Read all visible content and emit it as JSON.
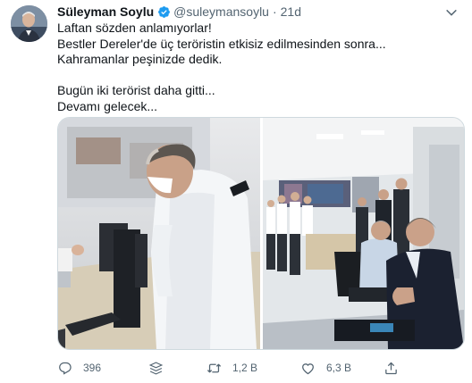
{
  "author": {
    "name": "Süleyman Soylu",
    "handle": "@suleymansoylu",
    "separator": "·",
    "time": "21d",
    "verified": true
  },
  "tweet": {
    "lines": [
      "Laftan sözden anlamıyorlar!",
      "Bestler Dereler'de üç teröristin etkisiz edilmesinden sonra...",
      "Kahramanlar peşinizde dedik.",
      "",
      "Bugün iki terörist daha gitti...",
      "Devamı gelecek..."
    ]
  },
  "media": {
    "photos": [
      "officer-at-computer-photo",
      "control-room-officers-photo"
    ]
  },
  "actions": {
    "reply_count": "396",
    "retweet_count": "1,2 B",
    "like_count": "6,3 B"
  },
  "colors": {
    "text": "#0f1419",
    "secondary": "#536471",
    "verified": "#1d9bf0",
    "border": "#cfd9de"
  },
  "icons": [
    "verified-badge-icon",
    "more-icon",
    "reply-icon",
    "analytics-icon",
    "retweet-icon",
    "like-icon",
    "share-icon"
  ]
}
